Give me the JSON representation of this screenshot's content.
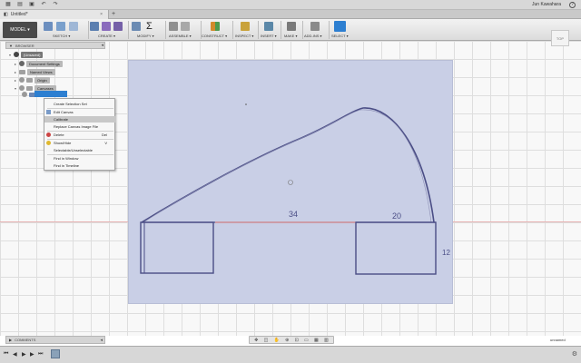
{
  "titlebar": {
    "user": "Jun Kawahara",
    "help": "?"
  },
  "tab": {
    "title": "Untitled*",
    "close": "×",
    "add": "+"
  },
  "toolbar": {
    "workspace": "MODEL ▾",
    "groups": [
      "SKETCH ▾",
      "CREATE ▾",
      "MODIFY ▾",
      "ASSEMBLE ▾",
      "CONSTRUCT ▾",
      "INSPECT ▾",
      "INSERT ▾",
      "MAKE ▾",
      "ADD-INS ▾",
      "SELECT ▾"
    ],
    "sigma": "Σ"
  },
  "viewcube": {
    "face": "TOP"
  },
  "browser": {
    "title": "BROWSER",
    "pin": "◂",
    "root": "(Unsaved)",
    "items": [
      "Document Settings",
      "Named Views",
      "Origin",
      "Canvases"
    ]
  },
  "context_menu": {
    "items": [
      {
        "label": "Create Selection Set",
        "shortcut": ""
      },
      {
        "label": "Edit Canvas",
        "shortcut": ""
      },
      {
        "label": "Calibrate",
        "shortcut": ""
      },
      {
        "label": "Replace Canvas Image File",
        "shortcut": ""
      },
      {
        "label": "Delete",
        "shortcut": "Del"
      },
      {
        "label": "Show/Hide",
        "shortcut": "V"
      },
      {
        "label": "Selectable/Unselectable",
        "shortcut": ""
      },
      {
        "label": "Find in Window",
        "shortcut": ""
      },
      {
        "label": "Find in Timeline",
        "shortcut": ""
      }
    ]
  },
  "sketch": {
    "dim_left": "34",
    "dim_right": "20",
    "dim_side": "12"
  },
  "comments": {
    "title": "COMMENTS",
    "pin": "◂"
  },
  "status": {
    "doc_name": "unnamed"
  },
  "colors": {
    "selection": "#2d7fd1",
    "toolbar_dark": "#4a4a4a"
  }
}
